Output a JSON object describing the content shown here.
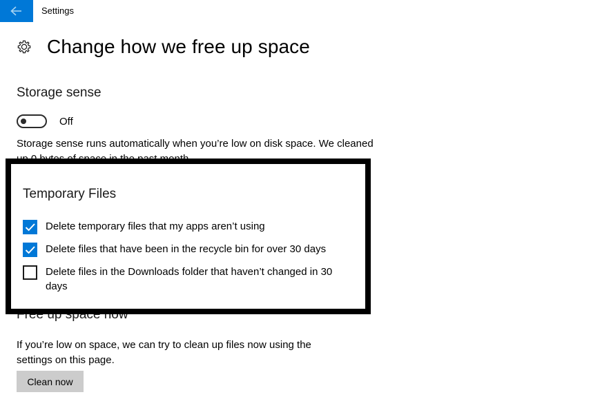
{
  "titlebar": {
    "back_icon": "back-arrow-icon",
    "app_title": "Settings"
  },
  "page": {
    "icon": "gear-icon",
    "title": "Change how we free up space"
  },
  "storage_sense": {
    "heading": "Storage sense",
    "toggle_state_label": "Off",
    "toggle_on": false,
    "description": "Storage sense runs automatically when you’re low on disk space. We cleaned up 0 bytes of space in the past month."
  },
  "temporary_files": {
    "heading": "Temporary Files",
    "options": [
      {
        "label": "Delete temporary files that my apps aren’t using",
        "checked": true
      },
      {
        "label": "Delete files that have been in the recycle bin for over 30 days",
        "checked": true
      },
      {
        "label": "Delete files in the Downloads folder that haven’t changed in 30 days",
        "checked": false
      }
    ],
    "highlight_color": "#000000"
  },
  "free_up_space": {
    "heading": "Free up space now",
    "description": "If you’re low on space, we can try to clean up files now using the settings on this page.",
    "button_label": "Clean now"
  },
  "colors": {
    "accent": "#0078d7",
    "button_bg": "#cccccc",
    "page_bg": "#ffffff"
  }
}
